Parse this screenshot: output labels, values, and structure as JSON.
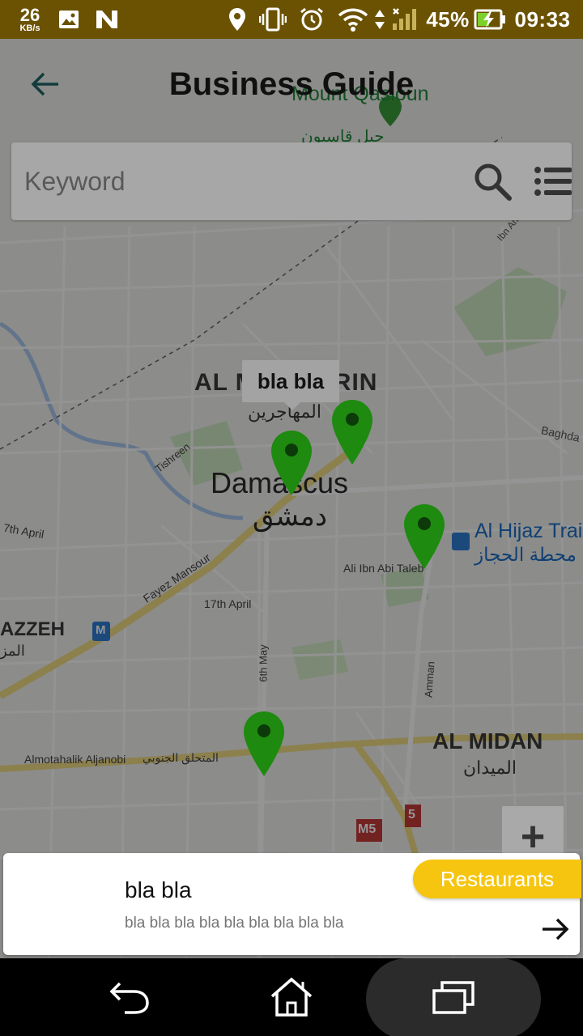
{
  "status_bar": {
    "net_speed": "26",
    "net_unit": "KB/s",
    "battery": "45%",
    "time": "09:33"
  },
  "header": {
    "title": "Business Guide"
  },
  "search": {
    "placeholder": "Keyword"
  },
  "map": {
    "labels": {
      "mount_qasioun": "Mount Qasioun",
      "qasioun_ar": "جبل قاسيون",
      "al_muhajirin": "AL MUHAJIRIN",
      "al_muhajirin_ar": "المهاجرين",
      "damascus": "Damascus",
      "damascus_ar": "دمشق",
      "tishreen": "Tishreen",
      "fayez_mansour": "Fayez Mansour",
      "april_17": "17th April",
      "april_17_left": "7th April",
      "mazzeh": "AZZEH",
      "mazzeh_ar": "المز",
      "may_6": "6th May",
      "amman": "Amman",
      "ali_ibn_abi_taleb": "Ali Ibn Abi Taleb",
      "al_hijaz": "Al Hijaz Trai",
      "al_hijaz_ar": "محطة الحجاز",
      "baghdad": "Baghda",
      "ibn_an": "Ibn An",
      "al_midan": "AL MIDAN",
      "al_midan_ar": "الميدان",
      "almotahalik": "Almotahalik Aljanobi",
      "almotahalik_ar": "المتحلق الجنوبي",
      "m5": "M5",
      "route5": "5",
      "metro_m": "M"
    },
    "tooltip": "bla bla",
    "zoom_in": "+"
  },
  "card": {
    "title": "bla bla",
    "description": "bla bla bla bla bla bla bla bla bla",
    "category": "Restaurants"
  },
  "colors": {
    "status_bar": "#6b5203",
    "marker": "#1e8a10",
    "badge": "#f5c510"
  }
}
